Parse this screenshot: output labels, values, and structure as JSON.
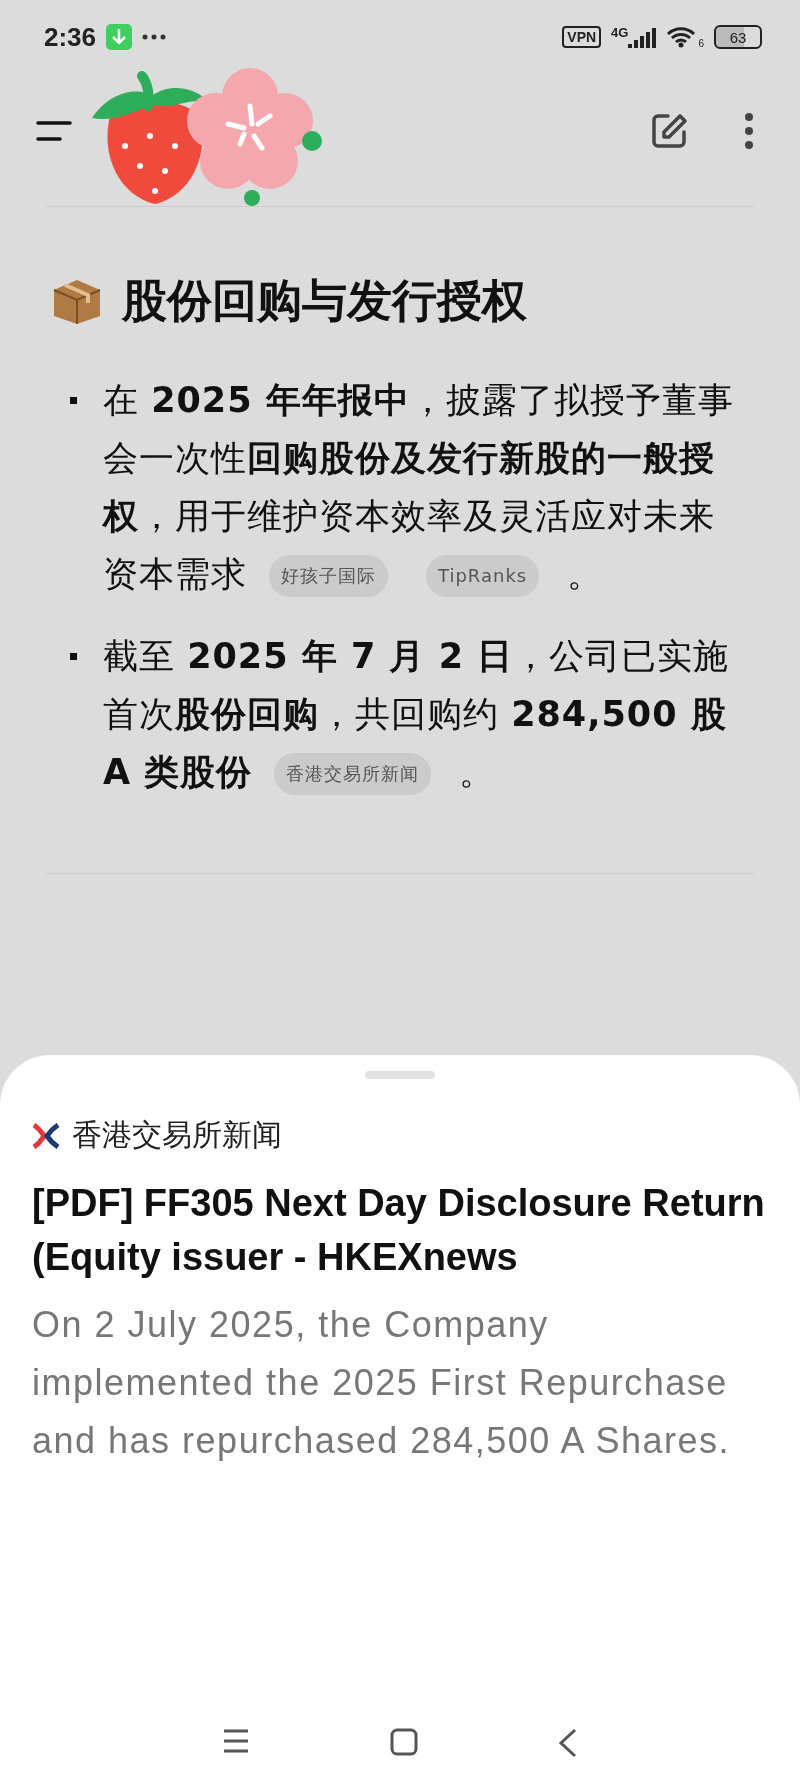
{
  "status_bar": {
    "time": "2:36",
    "vpn": "VPN",
    "network": "4G",
    "wifi_badge": "6",
    "battery": "63"
  },
  "article": {
    "heading": "股份回购与发行授权",
    "bullets": [
      {
        "text": "在 **2025 年年报中**，披露了拟授予董事会一次性**回购股份及发行新股的一般授权**，用于维护资本效率及灵活应对未来资本需求",
        "sources": [
          "好孩子国际",
          "TipRanks"
        ],
        "end": "。"
      },
      {
        "text": "截至 **2025 年 7 月 2 日**，公司已实施首次**股份回购**，共回购约 **284,500 股 A 类股份**",
        "sources": [
          "香港交易所新闻"
        ],
        "end": "。"
      }
    ]
  },
  "sheet": {
    "source": "香港交易所新闻",
    "title": "[PDF] FF305 Next Day Disclosure Return (Equity issuer - HKEXnews",
    "snippet": "On 2 July 2025, the Company implemented the 2025 First Repurchase and has repurchased 284,500 A Shares."
  }
}
